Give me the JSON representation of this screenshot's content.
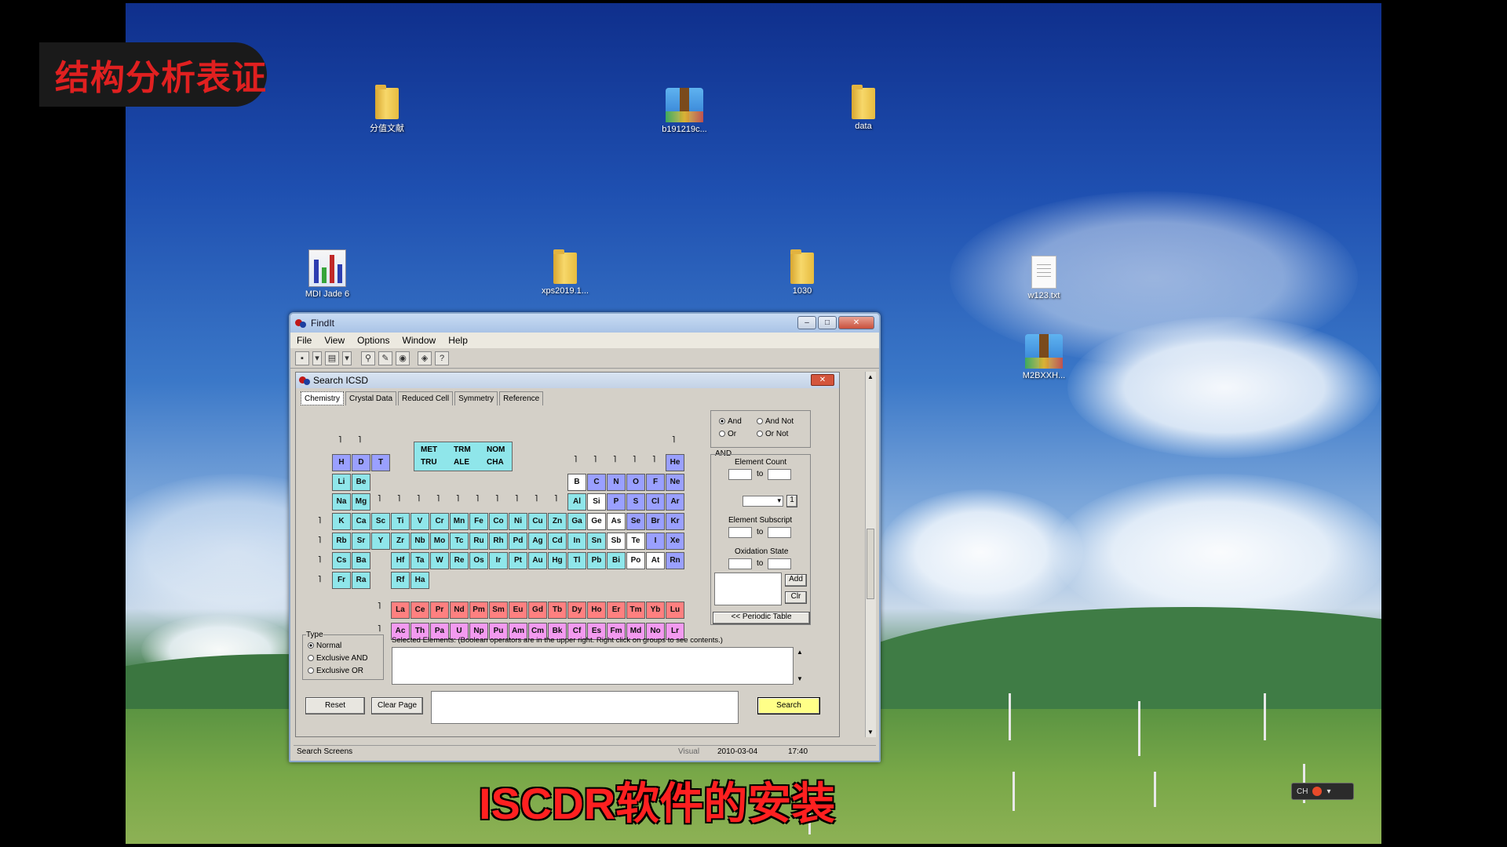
{
  "overlay": {
    "title_badge": "结构分析表证",
    "caption": "ISCDR软件的安装"
  },
  "desktop_icons": [
    {
      "label": "分值文献",
      "type": "folder-icon"
    },
    {
      "label": "b191219c...",
      "type": "archive-icon"
    },
    {
      "label": "data",
      "type": "folder-icon"
    },
    {
      "label": "MDI Jade 6",
      "type": "jade-app-icon"
    },
    {
      "label": "xps2019.1...",
      "type": "folder-icon"
    },
    {
      "label": "1030",
      "type": "folder-icon"
    },
    {
      "label": "w123.txt",
      "type": "text-file-icon"
    },
    {
      "label": "M2BXXH...",
      "type": "archive-icon"
    }
  ],
  "findit": {
    "title": "FindIt",
    "menu": [
      "File",
      "View",
      "Options",
      "Window",
      "Help"
    ],
    "search_window_title": "Search ICSD",
    "tabs": [
      "Chemistry",
      "Crystal Data",
      "Reduced Cell",
      "Symmetry",
      "Reference"
    ],
    "groups": [
      "MET",
      "TRM",
      "NOM",
      "TRU",
      "ALE",
      "CHA"
    ],
    "elements": {
      "r1": [
        "H",
        "D",
        "T"
      ],
      "he": "He",
      "r2a": [
        "Li",
        "Be"
      ],
      "r2b": [
        "B",
        "C",
        "N",
        "O",
        "F",
        "Ne"
      ],
      "r3a": [
        "Na",
        "Mg"
      ],
      "r3b": [
        "Al",
        "Si",
        "P",
        "S",
        "Cl",
        "Ar"
      ],
      "r4": [
        "K",
        "Ca",
        "Sc",
        "Ti",
        "V",
        "Cr",
        "Mn",
        "Fe",
        "Co",
        "Ni",
        "Cu",
        "Zn",
        "Ga",
        "Ge",
        "As",
        "Se",
        "Br",
        "Kr"
      ],
      "r5": [
        "Rb",
        "Sr",
        "Y",
        "Zr",
        "Nb",
        "Mo",
        "Tc",
        "Ru",
        "Rh",
        "Pd",
        "Ag",
        "Cd",
        "In",
        "Sn",
        "Sb",
        "Te",
        "I",
        "Xe"
      ],
      "r6a": [
        "Cs",
        "Ba"
      ],
      "r6b": [
        "Hf",
        "Ta",
        "W",
        "Re",
        "Os",
        "Ir",
        "Pt",
        "Au",
        "Hg",
        "Tl",
        "Pb",
        "Bi",
        "Po",
        "At",
        "Rn"
      ],
      "r7a": [
        "Fr",
        "Ra"
      ],
      "r7b": [
        "Rf",
        "Ha"
      ],
      "lan": [
        "La",
        "Ce",
        "Pr",
        "Nd",
        "Pm",
        "Sm",
        "Eu",
        "Gd",
        "Tb",
        "Dy",
        "Ho",
        "Er",
        "Tm",
        "Yb",
        "Lu"
      ],
      "act": [
        "Ac",
        "Th",
        "Pa",
        "U",
        "Np",
        "Pu",
        "Am",
        "Cm",
        "Bk",
        "Cf",
        "Es",
        "Fm",
        "Md",
        "No",
        "Lr"
      ]
    },
    "colors": {
      "s": "#8fe6ea",
      "p_nonmetal": "#9aa0ff",
      "halogen": "#9aa0ff",
      "transition": "#8fe6ea",
      "metalloid": "#ffffff",
      "post": "#8fe6ea",
      "lan": "#ff8080",
      "act": "#f39af0",
      "group": "#8fe6ea"
    },
    "bool": {
      "and": "And",
      "and_not": "And Not",
      "or": "Or",
      "or_not": "Or Not",
      "and_label": "AND"
    },
    "element_count": "Element Count",
    "to1": "to",
    "subscript_label": "Element Subscript",
    "to2": "to",
    "oxidation_label": "Oxidation State",
    "to3": "to",
    "spin_value": "1",
    "add": "Add",
    "clr": "Clr",
    "periodic_table_btn": "<< Periodic Table",
    "type_label": "Type",
    "type_normal": "Normal",
    "type_ex_and": "Exclusive AND",
    "type_ex_or": "Exclusive OR",
    "selected_label": "Selected Elements: (Boolean operators are in the upper right.  Right click on groups to see contents.)",
    "reset": "Reset",
    "clear_page": "Clear Page",
    "search": "Search",
    "status": {
      "left": "Search Screens",
      "mode": "Visual",
      "date": "2010-03-04",
      "time": "17:40"
    }
  },
  "tray": {
    "lang": "CH"
  }
}
